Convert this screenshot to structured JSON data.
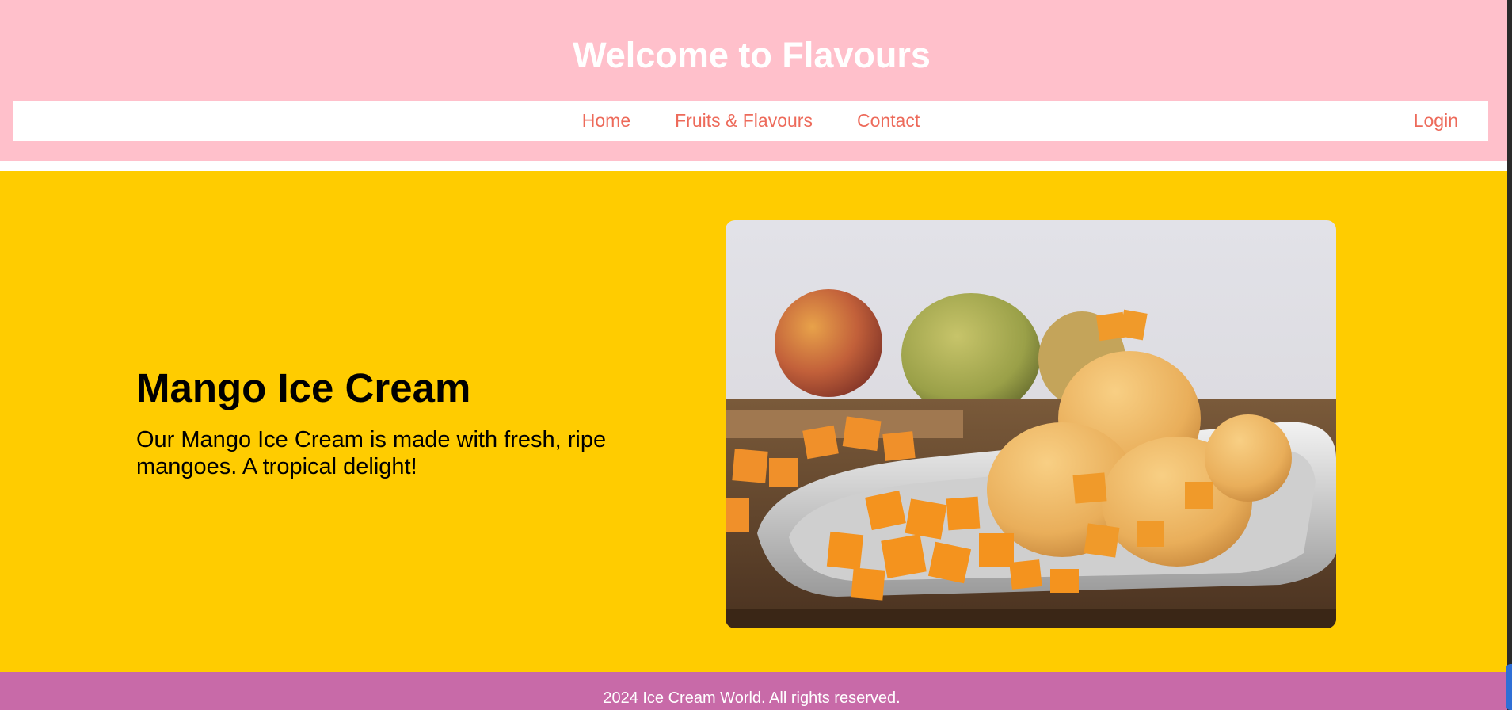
{
  "header": {
    "title": "Welcome to Flavours"
  },
  "nav": {
    "links": [
      "Home",
      "Fruits & Flavours",
      "Contact"
    ],
    "login_label": "Login"
  },
  "hero": {
    "title": "Mango Ice Cream",
    "description": "Our Mango Ice Cream is made with fresh, ripe mangoes. A tropical delight!",
    "image": "mango-ice-cream-photo"
  },
  "footer": {
    "text": "2024 Ice Cream World. All rights reserved."
  },
  "colors": {
    "header_bg": "#ffc0cb",
    "nav_link": "#ed6a5a",
    "hero_bg": "#ffcc00",
    "footer_bg": "#c86aa8"
  }
}
